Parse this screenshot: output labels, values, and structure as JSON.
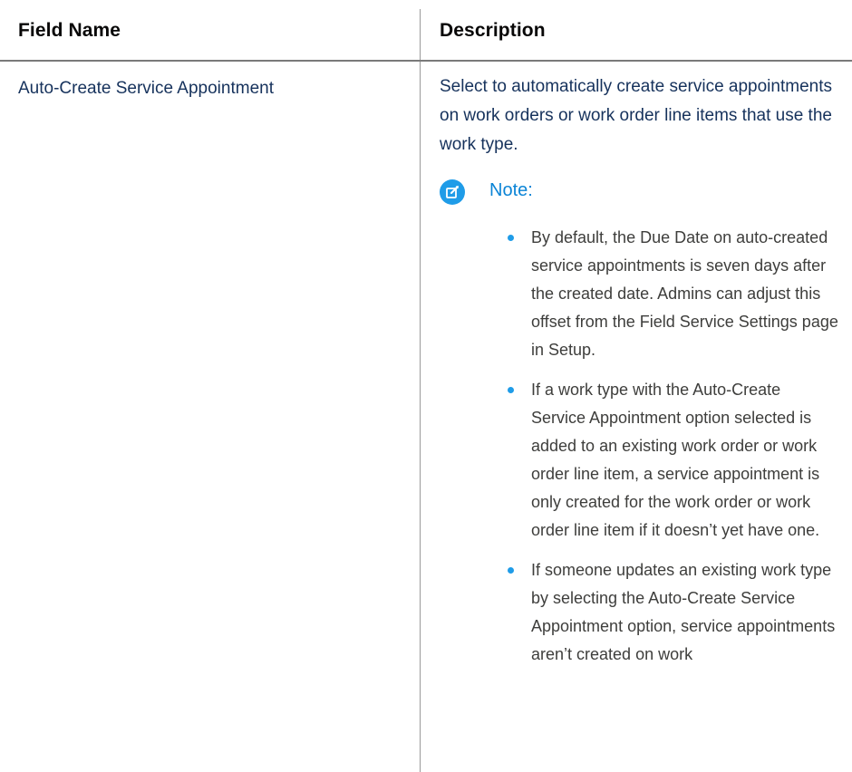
{
  "table": {
    "headers": {
      "field_name": "Field Name",
      "description": "Description"
    },
    "rows": [
      {
        "field_name": "Auto-Create Service Appointment",
        "description": "Select to automatically create service appointments on work orders or work order line items that use the work type.",
        "note": {
          "title": "Note:",
          "items": [
            "By default, the Due Date on auto-created service appointments is seven days after the created date. Admins can adjust this offset from the Field Service Settings page in Setup.",
            "If a work type with the Auto-Create Service Appointment option selected is added to an existing work order or work order line item, a service appointment is only created for the work order or work order line item if it doesn’t yet have one.",
            "If someone updates an existing work type by selecting the Auto-Create Service Appointment option, service appointments aren’t created on work"
          ]
        }
      }
    ]
  },
  "colors": {
    "accent": "#1f9ce8",
    "note_title": "#0b84d6",
    "text": "#16325c"
  },
  "icons": {
    "note": "edit-note-icon"
  }
}
